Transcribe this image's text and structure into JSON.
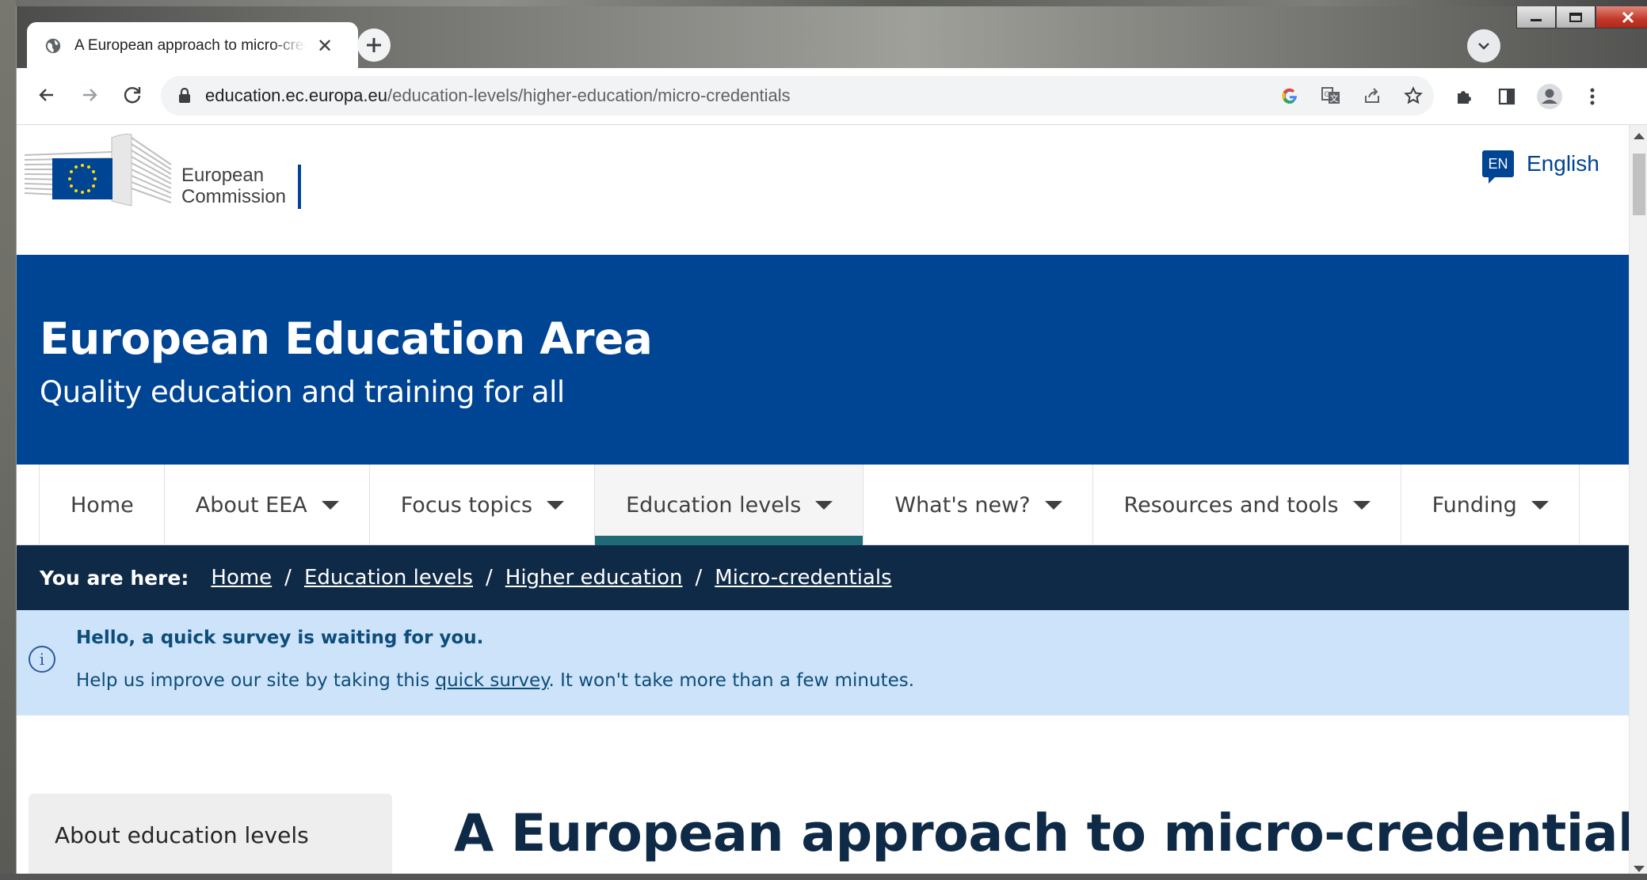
{
  "browser": {
    "tab_title": "A European approach to micro-credentials",
    "url_host": "education.ec.europa.eu",
    "url_path": "/education-levels/higher-education/micro-credentials"
  },
  "site": {
    "logo_line1": "European",
    "logo_line2": "Commission",
    "lang_code": "EN",
    "lang_label": "English",
    "banner_title": "European Education Area",
    "banner_subtitle": "Quality education and training for all"
  },
  "menu": {
    "items": [
      {
        "label": "Home"
      },
      {
        "label": "About EEA"
      },
      {
        "label": "Focus topics"
      },
      {
        "label": "Education levels"
      },
      {
        "label": "What's new?"
      },
      {
        "label": "Resources and tools"
      },
      {
        "label": "Funding"
      }
    ]
  },
  "breadcrumb": {
    "label": "You are here:",
    "items": [
      "Home",
      "Education levels",
      "Higher education",
      "Micro-credentials"
    ],
    "separator": "/"
  },
  "notice": {
    "title": "Hello, a quick survey is waiting for you.",
    "text_before": "Help us improve our site by taking this ",
    "link": "quick survey",
    "text_after": ". It won't take more than a few minutes.",
    "icon": "i"
  },
  "sidebar": {
    "label": "About education levels"
  },
  "page": {
    "title": "A European approach to micro-credentials"
  },
  "colors": {
    "primary": "#004494",
    "dark_navy": "#0e2a47",
    "notice_bg": "#cce3f9",
    "active_menu_underline": "#1f6b75"
  }
}
